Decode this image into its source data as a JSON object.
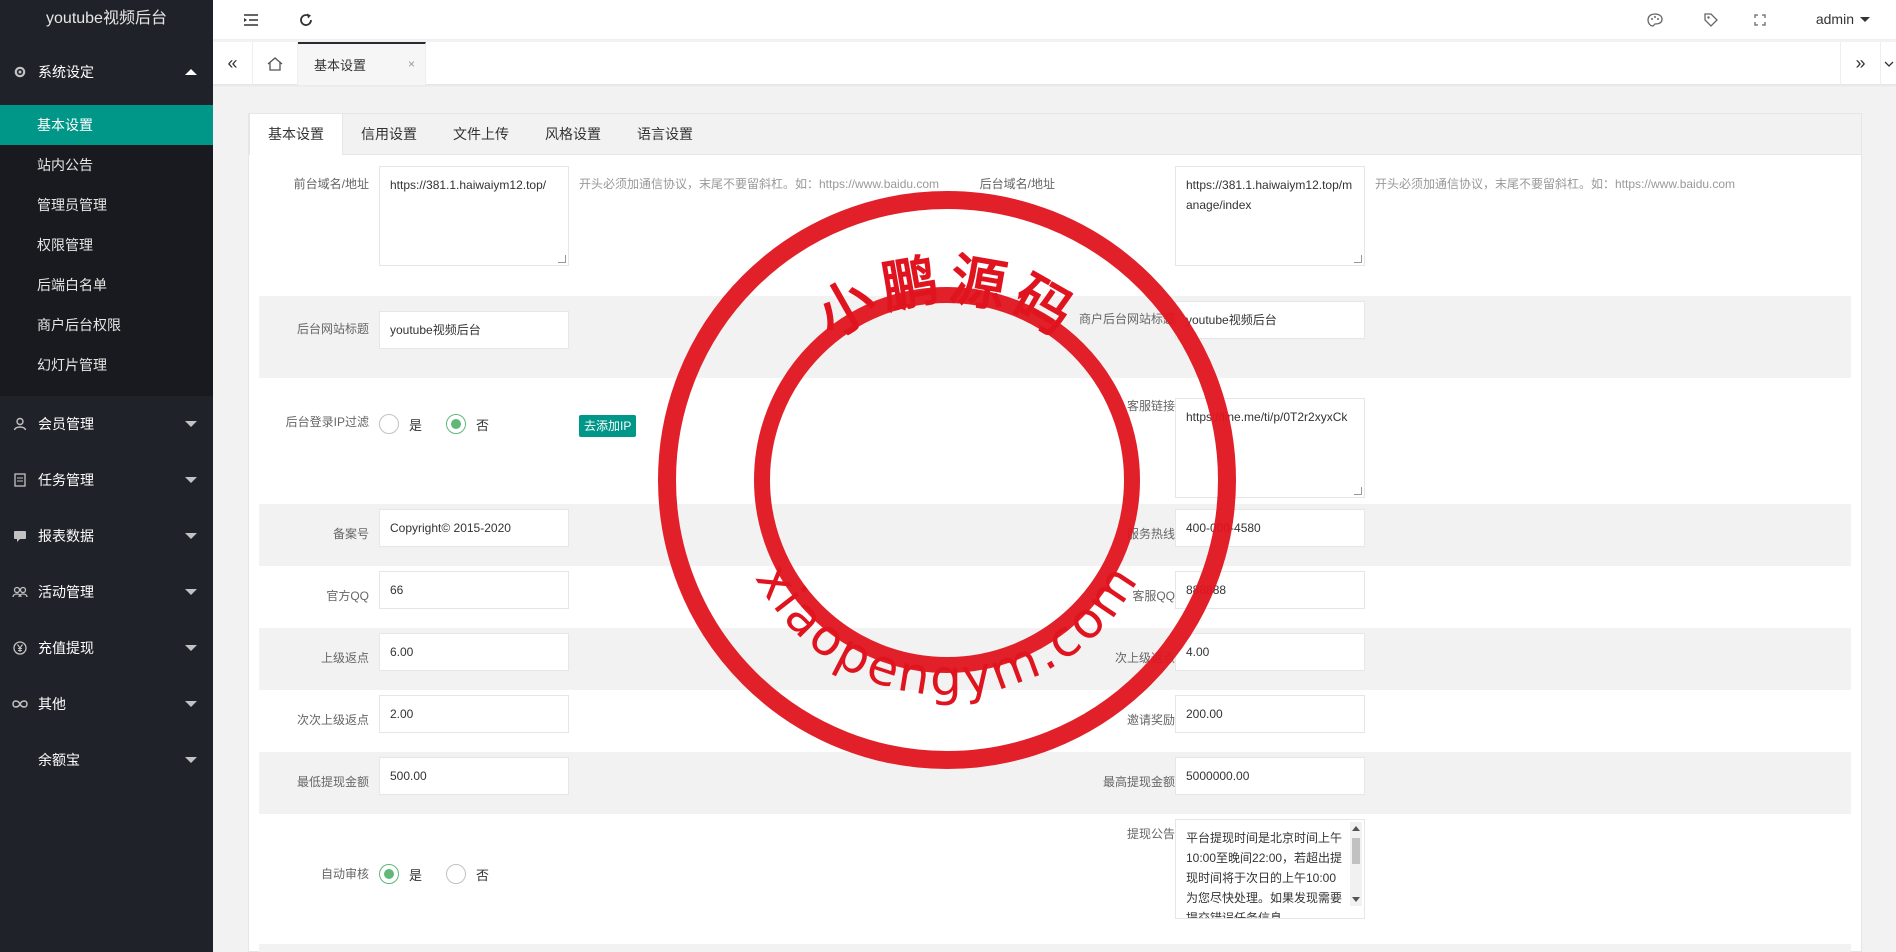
{
  "sidebar": {
    "logo": "youtube视频后台",
    "groups": [
      {
        "label": "系统设定",
        "icon": "gear-icon"
      },
      {
        "label": "会员管理",
        "icon": "user-icon"
      },
      {
        "label": "任务管理",
        "icon": "document-icon"
      },
      {
        "label": "报表数据",
        "icon": "chat-icon"
      },
      {
        "label": "活动管理",
        "icon": "group-icon"
      },
      {
        "label": "充值提现",
        "icon": "yen-icon"
      },
      {
        "label": "其他",
        "icon": "infinity-icon"
      },
      {
        "label": "余额宝",
        "icon": ""
      }
    ],
    "sub_items": [
      "基本设置",
      "站内公告",
      "管理员管理",
      "权限管理",
      "后端白名单",
      "商户后台权限",
      "幻灯片管理"
    ]
  },
  "header": {
    "user": "admin"
  },
  "tabbar": {
    "current_tab": "基本设置",
    "close": "×"
  },
  "inner_tabs": [
    "基本设置",
    "信用设置",
    "文件上传",
    "风格设置",
    "语言设置"
  ],
  "form": {
    "front_domain": {
      "label": "前台域名/地址",
      "value": "https://381.1.haiwaiym12.top/",
      "hint": "开头必须加通信协议，末尾不要留斜杠。如：https://www.baidu.com"
    },
    "back_domain": {
      "label": "后台域名/地址",
      "value": "https://381.1.haiwaiym12.top/manage/index",
      "hint": "开头必须加通信协议，末尾不要留斜杠。如：https://www.baidu.com"
    },
    "admin_title": {
      "label": "后台网站标题",
      "value": "youtube视频后台"
    },
    "merchant_title": {
      "label": "商户后台网站标题",
      "value": "youtube视频后台"
    },
    "ip_filter": {
      "label": "后台登录IP过滤",
      "yes": "是",
      "no": "否",
      "button": "去添加IP"
    },
    "service_link": {
      "label": "客服链接",
      "value": "https://line.me/ti/p/0T2r2xyxCk"
    },
    "icp": {
      "label": "备案号",
      "value": "Copyright© 2015-2020"
    },
    "hotline": {
      "label": "服务热线",
      "value": "400-000-4580"
    },
    "qq": {
      "label": "官方QQ",
      "value": "66"
    },
    "service_qq": {
      "label": "客服QQ",
      "value": "888888"
    },
    "upper_rebate": {
      "label": "上级返点",
      "value": "6.00"
    },
    "second_rebate": {
      "label": "次上级返点",
      "value": "4.00"
    },
    "third_rebate": {
      "label": "次次上级返点",
      "value": "2.00"
    },
    "invite_reward": {
      "label": "邀请奖励",
      "value": "200.00"
    },
    "min_withdraw": {
      "label": "最低提现金额",
      "value": "500.00"
    },
    "max_withdraw": {
      "label": "最高提现金额",
      "value": "5000000.00"
    },
    "auto_review": {
      "label": "自动审核",
      "yes": "是",
      "no": "否"
    },
    "withdraw_notice": {
      "label": "提现公告",
      "value": "平台提现时间是北京时间上午10:00至晚间22:00，若超出提现时间将于次日的上午10:00为您尽快处理。如果发现需要提交错误任务信息"
    }
  },
  "watermark": {
    "top_text": "小鹏源码",
    "bottom_text": "xiaopengym.com",
    "color": "#e0141e"
  },
  "colors": {
    "accent": "#009688",
    "radio": "#5fb878",
    "sidebar_bg": "#20222a"
  }
}
